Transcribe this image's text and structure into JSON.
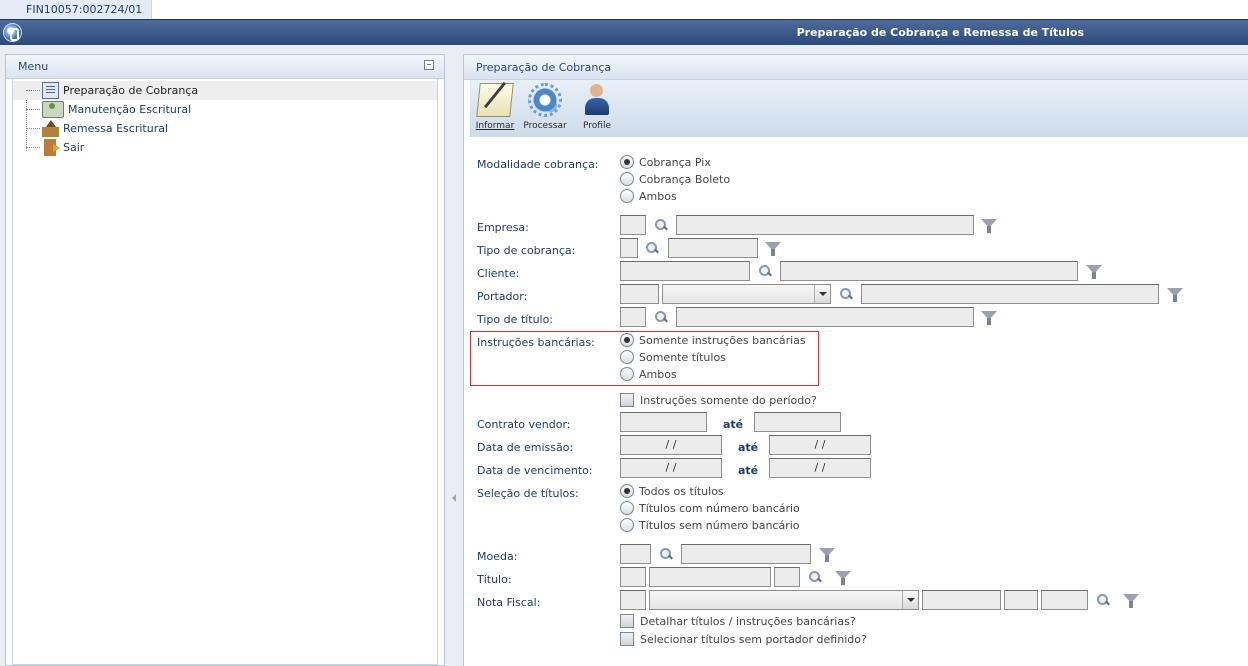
{
  "tab": {
    "label": "FIN10057:002724/01"
  },
  "window": {
    "title": "Preparação de Cobrança e Remessa de Títulos"
  },
  "menu": {
    "header": "Menu",
    "items": [
      {
        "label": "Preparação de Cobrança",
        "icon": "billing-prep-icon",
        "selected": true
      },
      {
        "label": "Manutenção Escritural",
        "icon": "maintenance-icon",
        "selected": false
      },
      {
        "label": "Remessa Escritural",
        "icon": "remittance-icon",
        "selected": false
      },
      {
        "label": "Sair",
        "icon": "exit-door-icon",
        "selected": false
      }
    ]
  },
  "main": {
    "header": "Preparação de Cobrança",
    "toolbar": {
      "informar": "Informar",
      "processar": "Processar",
      "profile": "Profile"
    },
    "modalidade": {
      "label": "Modalidade cobrança:",
      "options": [
        "Cobrança Pix",
        "Cobrança Boleto",
        "Ambos"
      ],
      "selected": 0
    },
    "empresa": {
      "label": "Empresa:"
    },
    "tipo_cobranca": {
      "label": "Tipo de cobrança:"
    },
    "cliente": {
      "label": "Cliente:"
    },
    "portador": {
      "label": "Portador:"
    },
    "tipo_titulo": {
      "label": "Tipo de título:"
    },
    "instrucoes": {
      "label": "Instruções bancárias:",
      "options": [
        "Somente instruções bancárias",
        "Somente títulos",
        "Ambos"
      ],
      "selected": 0
    },
    "instrucoes_periodo": {
      "label": "Instruções somente do período?",
      "checked": false
    },
    "contrato_vendor": {
      "label": "Contrato vendor:",
      "ate": "até"
    },
    "data_emissao": {
      "label": "Data de emissão:",
      "ate": "até",
      "from": "/ /",
      "to": "/ /"
    },
    "data_vencimento": {
      "label": "Data de vencimento:",
      "ate": "até",
      "from": "/ /",
      "to": "/ /"
    },
    "selecao_titulos": {
      "label": "Seleção de títulos:",
      "options": [
        "Todos os títulos",
        "Títulos com número bancário",
        "Títulos sem número bancário"
      ],
      "selected": 0
    },
    "moeda": {
      "label": "Moeda:"
    },
    "titulo": {
      "label": "Título:"
    },
    "nota_fiscal": {
      "label": "Nota Fiscal:"
    },
    "detalhar": {
      "label": "Detalhar títulos / instruções bancárias?",
      "checked": false
    },
    "sem_portador": {
      "label": "Selecionar títulos sem portador definido?",
      "checked": false
    }
  },
  "colors": {
    "titlebar": "#2c4a7c",
    "highlight_border": "#d23232",
    "label_text": "#1e3d6b"
  }
}
